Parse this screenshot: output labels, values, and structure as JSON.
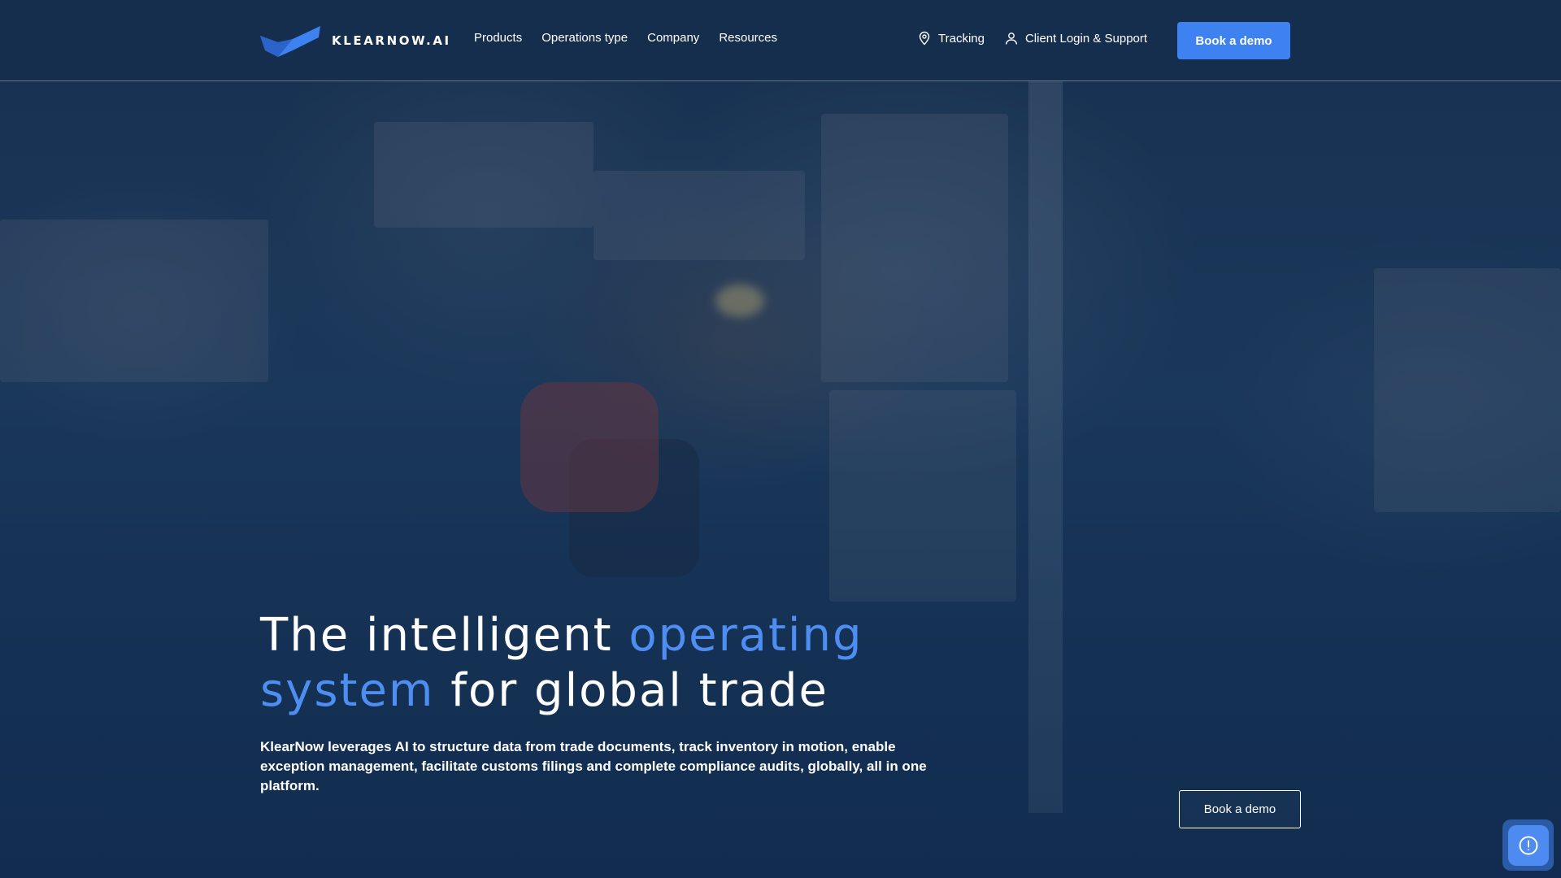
{
  "brand": {
    "name": "KLEARNOW.AI",
    "accent_color": "#3d82f0",
    "nav_bg": "#152e4d"
  },
  "nav": {
    "links": [
      "Products",
      "Operations type",
      "Company",
      "Resources"
    ],
    "tracking": {
      "label": "Tracking",
      "icon": "map-pin-icon"
    },
    "login": {
      "label": "Client Login & Support",
      "icon": "user-icon"
    },
    "cta": "Book a demo"
  },
  "hero": {
    "headline_part1": "The intelligent ",
    "headline_accent1": "operating",
    "headline_accent2": "system",
    "headline_part2": " for global trade",
    "description": "KlearNow leverages AI to structure data from trade documents, track inventory in motion, enable exception management, facilitate customs filings and complete compliance audits, globally, all in one platform.",
    "cta": "Book a demo",
    "background_image": "warehouse forklift photo"
  },
  "help_widget": {
    "icon": "alert-circle-icon"
  }
}
